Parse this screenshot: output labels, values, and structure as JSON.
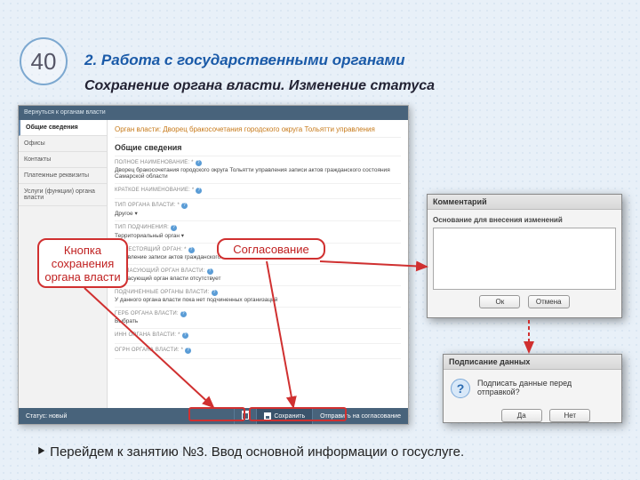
{
  "slide": {
    "number": "40"
  },
  "headings": {
    "h1": "2. Работа с государственными органами",
    "h2": "Сохранение органа власти. Изменение статуса"
  },
  "app": {
    "back_link": "Вернуться к органам власти",
    "sidebar": {
      "items": [
        {
          "label": "Общие сведения",
          "active": true
        },
        {
          "label": "Офисы"
        },
        {
          "label": "Контакты"
        },
        {
          "label": "Платежные реквизиты"
        },
        {
          "label": "Услуги (функции) органа власти"
        }
      ]
    },
    "main": {
      "breadcrumb": "Орган власти: Дворец бракосочетания городского округа Тольятти управления",
      "section": "Общие сведения",
      "fields": [
        {
          "label": "ПОЛНОЕ НАИМЕНОВАНИЕ: *",
          "value": "Дворец бракосочетания городского округа Тольятти управления записи актов гражданского состояния Самарской области"
        },
        {
          "label": "КРАТКОЕ НАИМЕНОВАНИЕ: *",
          "value": ""
        },
        {
          "label": "ТИП ОРГАНА ВЛАСТИ: *",
          "value": "Другое ▾"
        },
        {
          "label": "ТИП ПОДЧИНЕНИЯ:",
          "value": "Территориальный орган ▾"
        },
        {
          "label": "ВЫШЕСТОЯЩИЙ ОРГАН: *",
          "value": "Управление записи актов гражданского состояния Самарской области"
        },
        {
          "label": "СОГЛАСУЮЩИЙ ОРГАН ВЛАСТИ:",
          "value": "Согласующий орган власти отсутствует"
        },
        {
          "label": "ПОДЧИНЕННЫЕ ОРГАНЫ ВЛАСТИ:",
          "value": "У данного органа власти пока нет подчиненных организаций"
        },
        {
          "label": "ГЕРБ ОРГАНА ВЛАСТИ:",
          "value": "Выбрать"
        },
        {
          "label": "ИНН ОРГАНА ВЛАСТИ: *",
          "value": ""
        },
        {
          "label": "ОГРН ОРГАНА ВЛАСТИ: *",
          "value": ""
        }
      ]
    },
    "statusbar": {
      "status": "Статус: новый",
      "delete": "",
      "save": "Сохранить",
      "send": "Отправить на согласование"
    }
  },
  "callouts": {
    "save": "Кнопка сохранения органа власти",
    "approve": "Согласование"
  },
  "dialogs": {
    "comment": {
      "title": "Комментарий",
      "label": "Основание для внесения изменений",
      "ok": "Ок",
      "cancel": "Отмена"
    },
    "sign": {
      "title": "Подписание данных",
      "message": "Подписать данные перед отправкой?",
      "yes": "Да",
      "no": "Нет"
    }
  },
  "footer": {
    "bullet": "⯈",
    "text": "Перейдем к занятию №3. Ввод основной информации о госуслуге."
  }
}
